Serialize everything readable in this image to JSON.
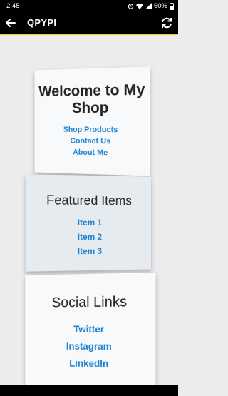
{
  "status_bar": {
    "time": "2:45",
    "battery": "60%"
  },
  "app_bar": {
    "title": "QPYPI"
  },
  "cards": [
    {
      "title": "Welcome to My Shop",
      "links": [
        "Shop Products",
        "Contact Us",
        "About Me"
      ]
    },
    {
      "title": "Featured Items",
      "links": [
        "Item 1",
        "Item 2",
        "Item 3"
      ]
    },
    {
      "title": "Social Links",
      "links": [
        "Twitter",
        "Instagram",
        "LinkedIn"
      ]
    }
  ],
  "colors": {
    "link": "#1a7fcf",
    "accent": "#f5c518",
    "bar": "#000000",
    "background": "#ececec"
  },
  "icons": [
    "back-arrow-icon",
    "refresh-icon",
    "wifi-icon",
    "signal-icon",
    "battery-icon",
    "alarm-icon"
  ]
}
